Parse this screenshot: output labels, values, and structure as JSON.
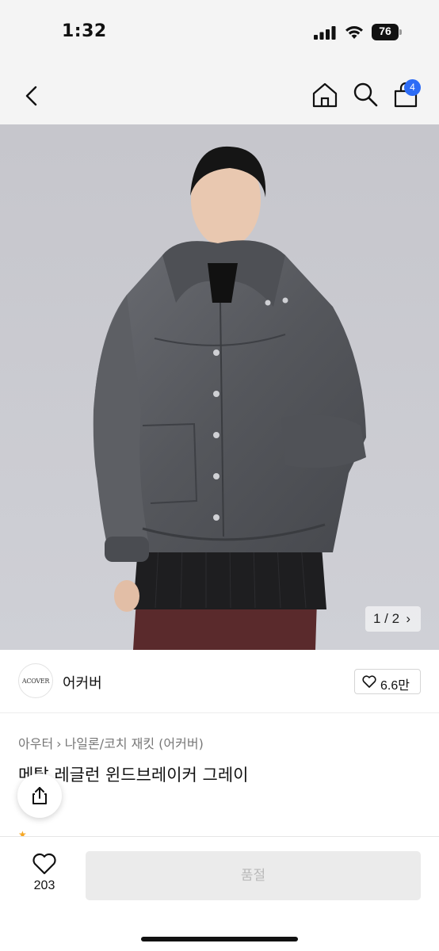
{
  "status_bar": {
    "time": "1:32",
    "battery": "76"
  },
  "nav": {
    "cart_count": "4"
  },
  "image": {
    "counter": "1 / 2"
  },
  "brand": {
    "logo_text": "ACOVER",
    "name": "어커버",
    "likes": "6.6만"
  },
  "product": {
    "breadcrumb": [
      "아우터",
      "나일론/코치 재킷 (어커버)"
    ],
    "title": "메탈 레글런 윈드브레이커 그레이"
  },
  "bottom": {
    "wish_count": "203",
    "buy_label": "품절"
  },
  "colors": {
    "accent": "#2d6cf6",
    "jacket": "#5a5c61",
    "background": "#c8c9cf"
  }
}
